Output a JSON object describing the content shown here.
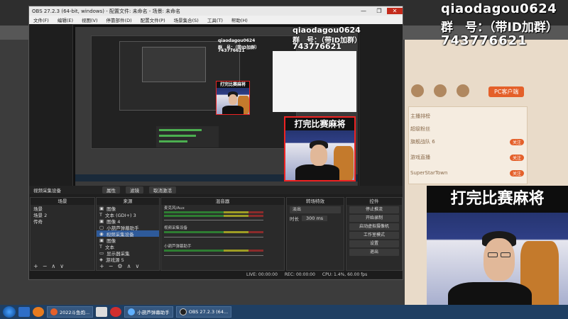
{
  "overlay": {
    "id": "qiaodagou0624",
    "group": "群　号：（带ID加群）",
    "number": "743776621"
  },
  "inner_overlay": {
    "id": "qiaodagou0624",
    "group": "群　号：（带ID加群）",
    "number": "743776621"
  },
  "webcam_banner": "打完比赛麻将",
  "background_app": {
    "pc_button": "PC客户端",
    "list_items": [
      "主播排榜",
      "超级粉丝",
      "旗舰战队 6",
      "游戏直播",
      "SuperStarTown"
    ],
    "list_pill": "关注"
  },
  "obs": {
    "title": "OBS 27.2.3 (64-bit, windows) - 配置文件: 未命名 - 场景: 未命名",
    "menu": [
      "文件(F)",
      "编辑(E)",
      "视图(V)",
      "停靠部件(D)",
      "配置文件(P)",
      "场景集合(S)",
      "工具(T)",
      "帮助(H)"
    ],
    "window_controls": [
      "—",
      "❐",
      "✕"
    ],
    "dock_bar": {
      "label": "视频采集设备",
      "properties": "属性",
      "filters": "滤镜",
      "deactivate": "取消激活"
    },
    "scenes": {
      "header": "场景",
      "items": [
        "场景",
        "场景 2",
        "传奇"
      ]
    },
    "sources": {
      "header": "来源",
      "items": [
        "图像",
        "文本 (GDI+) 3",
        "图像 4",
        "小葫芦弹幕助手",
        "视频采集设备",
        "图像",
        "文本",
        "显示器采集",
        "游戏源 5"
      ]
    },
    "mixer": {
      "header": "混音器",
      "channels": [
        "麦克风/Aux",
        "视频采集设备",
        "小葫芦弹幕助手"
      ]
    },
    "transitions": {
      "header": "转场特效",
      "type": "淡出",
      "duration_label": "时长",
      "duration": "300 ms"
    },
    "controls": {
      "header": "控件",
      "buttons": [
        "停止推流",
        "开始录制",
        "启动虚拟摄像机",
        "工作室模式",
        "设置",
        "退出"
      ]
    },
    "status": {
      "live": "LIVE: 00:00:00",
      "rec": "REC: 00:00:00",
      "cpu": "CPU: 1.4%, 60.00 fps"
    }
  },
  "taskbar": {
    "tasks": [
      "2022斗鱼炮...",
      "小葫芦弹幕助手",
      "OBS 27.2.3 (64..."
    ]
  },
  "colors": {
    "accent_red": "#e22222",
    "obs_bg": "#1e1e1e",
    "taskbar": "#1f3f63",
    "pc_button": "#e4602a"
  }
}
